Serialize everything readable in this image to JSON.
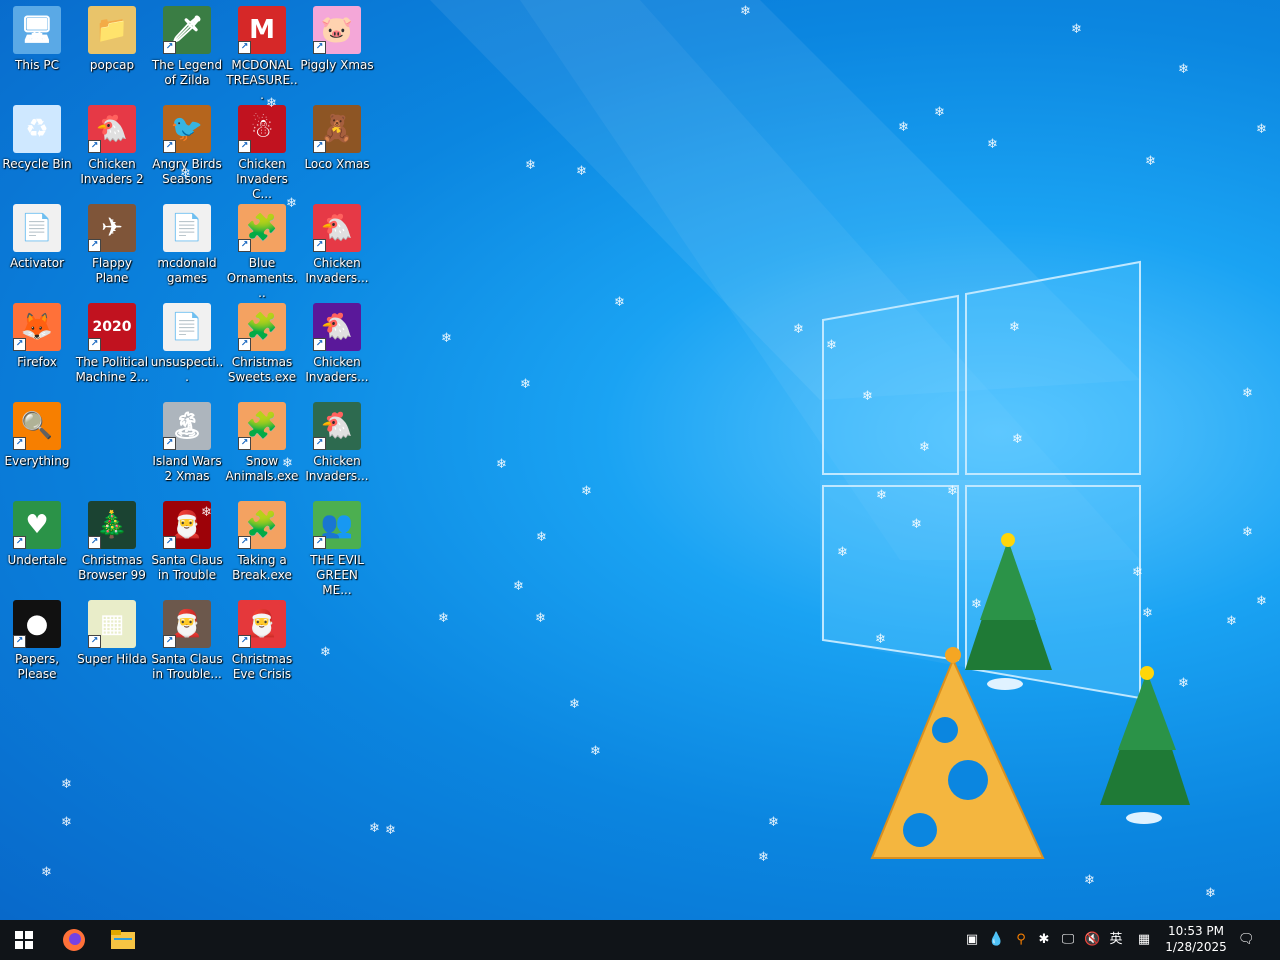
{
  "desktop_icons": [
    {
      "label": "This PC",
      "icon": "computer-icon",
      "color": "#5aa9e6"
    },
    {
      "label": "popcap",
      "icon": "folder-icon",
      "color": "#e9c46a"
    },
    {
      "label": "The Legend of Zilda",
      "icon": "zelda-game-icon",
      "color": "#3a7d44"
    },
    {
      "label": "MCDONAL TREASURE...",
      "icon": "mcdonalds-icon",
      "color": "#d62828"
    },
    {
      "label": "Piggly Xmas",
      "icon": "pig-icon",
      "color": "#f4a7d8"
    },
    {
      "label": "Recycle Bin",
      "icon": "recycle-bin-icon",
      "color": "#cfe8ff"
    },
    {
      "label": "Chicken Invaders 2",
      "icon": "chicken-icon",
      "color": "#e63946"
    },
    {
      "label": "Angry Birds Seasons",
      "icon": "angry-bird-icon",
      "color": "#b5651d"
    },
    {
      "label": "Chicken Invaders C...",
      "icon": "snowman-icon",
      "color": "#c1121f"
    },
    {
      "label": "Loco Xmas",
      "icon": "bear-icon",
      "color": "#8d5524"
    },
    {
      "label": "Activator",
      "icon": "file-icon",
      "color": "#f1f1f1"
    },
    {
      "label": "Flappy Plane",
      "icon": "plane-icon",
      "color": "#7f5539"
    },
    {
      "label": "mcdonald games",
      "icon": "file-icon",
      "color": "#f1f1f1"
    },
    {
      "label": "Blue Ornaments...",
      "icon": "puzzle-icon",
      "color": "#f4a261"
    },
    {
      "label": "Chicken Invaders...",
      "icon": "chicken-icon",
      "color": "#e63946"
    },
    {
      "label": "Firefox",
      "icon": "firefox-icon",
      "color": "#ff7139"
    },
    {
      "label": "The Political Machine 2...",
      "icon": "political-2020-icon",
      "color": "#c1121f"
    },
    {
      "label": "unsuspecti...",
      "icon": "file-icon",
      "color": "#f1f1f1"
    },
    {
      "label": "Christmas Sweets.exe",
      "icon": "puzzle-icon",
      "color": "#f4a261"
    },
    {
      "label": "Chicken Invaders...",
      "icon": "chicken-icon",
      "color": "#5a189a"
    },
    {
      "label": "Everything",
      "icon": "magnifier-icon",
      "color": "#f77f00"
    },
    {
      "label": "Island Wars 2 Xmas",
      "icon": "island-icon",
      "color": "#adb5bd"
    },
    {
      "label": "Snow Animals.exe",
      "icon": "puzzle-icon",
      "color": "#f4a261"
    },
    {
      "label": "Chicken Invaders...",
      "icon": "chicken-icon",
      "color": "#2d6a4f"
    },
    {
      "label": "Undertale",
      "icon": "undertale-icon",
      "color": "#2b9348"
    },
    {
      "label": "Christmas Browser 99",
      "icon": "christmas-tree-icon",
      "color": "#1b4332"
    },
    {
      "label": "Santa Claus in Trouble",
      "icon": "santa-icon",
      "color": "#9d0208"
    },
    {
      "label": "Taking a Break.exe",
      "icon": "puzzle-icon",
      "color": "#f4a261"
    },
    {
      "label": "THE EVIL GREEN ME...",
      "icon": "users-icon",
      "color": "#4caf50"
    },
    {
      "label": "Papers, Please",
      "icon": "papers-please-icon",
      "color": "#111111"
    },
    {
      "label": "Super Hilda",
      "icon": "pixel-game-icon",
      "color": "#e9edc9"
    },
    {
      "label": "Santa Claus in Trouble...",
      "icon": "santa-icon",
      "color": "#6c584c"
    },
    {
      "label": "Christmas Eve Crisis",
      "icon": "santa-icon",
      "color": "#e5383b"
    }
  ],
  "taskbar": {
    "start": "start-icon",
    "pinned": [
      {
        "name": "firefox-icon",
        "color": "#ff7139"
      },
      {
        "name": "file-explorer-icon",
        "color": "#f6c443"
      }
    ],
    "tray_ime": "英",
    "clock_time": "10:53 PM",
    "clock_date": "1/28/2025"
  },
  "colors": {
    "taskbar": "#101418",
    "accent": "#0b86e0"
  }
}
